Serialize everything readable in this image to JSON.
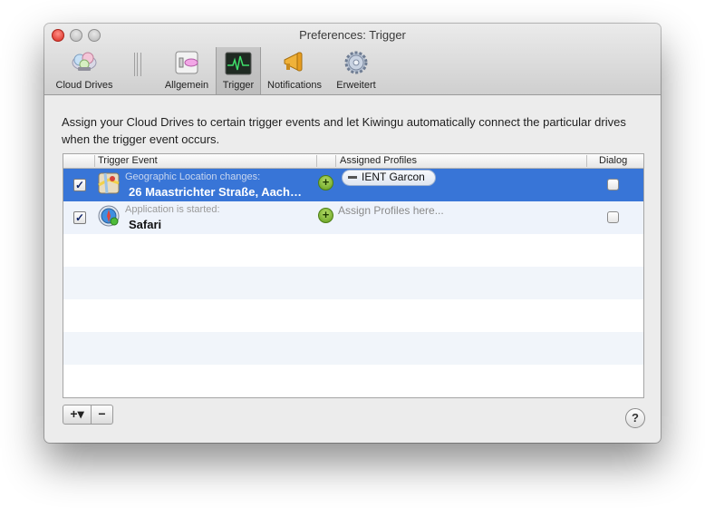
{
  "window": {
    "title": "Preferences: Trigger"
  },
  "toolbar": {
    "items": [
      {
        "label": "Cloud Drives",
        "icon": "cloud-drives-icon"
      },
      {
        "label": "Allgemein",
        "icon": "general-switch-icon"
      },
      {
        "label": "Trigger",
        "icon": "activity-monitor-icon",
        "selected": true
      },
      {
        "label": "Notifications",
        "icon": "megaphone-icon"
      },
      {
        "label": "Erweitert",
        "icon": "gear-icon"
      }
    ]
  },
  "description": "Assign your Cloud Drives to certain trigger events and let Kiwingu automatically connect the particular drives when the trigger event occurs.",
  "table": {
    "columns": {
      "event": "Trigger Event",
      "profiles": "Assigned Profiles",
      "dialog": "Dialog"
    },
    "rows": [
      {
        "enabled": true,
        "event_title": "Geographic Location changes:",
        "event_value": "26 Maastrichter Straße, Aach…",
        "profile": "IENT Garcon",
        "dialog": false,
        "selected": true,
        "icon": "maps-icon"
      },
      {
        "enabled": true,
        "event_title": "Application is started:",
        "event_value": "Safari",
        "profile_placeholder": "Assign Profiles here...",
        "dialog": false,
        "selected": false,
        "icon": "safari-icon"
      }
    ]
  },
  "bottom": {
    "add_label": "+▾",
    "remove_label": "−",
    "help_label": "?"
  },
  "colors": {
    "selection": "#3875d7",
    "stripe": "#eef3fb",
    "add_green": "#6aa51f"
  }
}
